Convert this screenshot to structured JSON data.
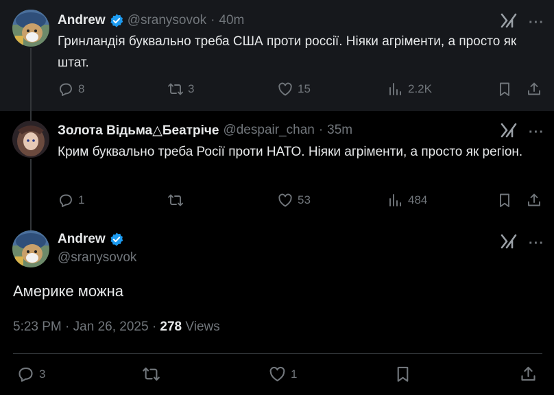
{
  "tweets": [
    {
      "name": "Andrew",
      "verified": true,
      "handle": "@sranysovok",
      "dot": "·",
      "time": "40m",
      "text": "Гринландія буквально треба США проти россії. Ніяки агріменти, а просто як штат.",
      "stats": {
        "replies": "8",
        "reposts": "3",
        "likes": "15",
        "views": "2.2K"
      }
    },
    {
      "name": "Золота Відьма△Беатріче",
      "verified": false,
      "handle": "@despair_chan",
      "dot": "·",
      "time": "35m",
      "text": "Крим буквально треба Росії проти НАТО. Ніяки агріменти, а просто як регіон.",
      "stats": {
        "replies": "1",
        "reposts": "",
        "likes": "53",
        "views": "484"
      }
    }
  ],
  "main": {
    "name": "Andrew",
    "handle": "@sranysovok",
    "text": "Америке можна",
    "time": "5:23 PM",
    "sep": "·",
    "date": "Jan 26, 2025",
    "views_count": "278",
    "views_label": "Views",
    "stats": {
      "replies": "3",
      "reposts": "",
      "likes": "1"
    }
  },
  "icons": {
    "reply": "reply-icon",
    "repost": "repost-icon",
    "like": "heart-icon",
    "views": "views-icon",
    "bookmark": "bookmark-icon",
    "share": "share-icon",
    "grok": "grok-icon",
    "more": "more-icon",
    "verified": "verified-badge-icon"
  },
  "colors": {
    "verified": "#1d9bf0",
    "muted": "#71767b",
    "text": "#e7e9ea",
    "hover_bg": "#16181c"
  }
}
